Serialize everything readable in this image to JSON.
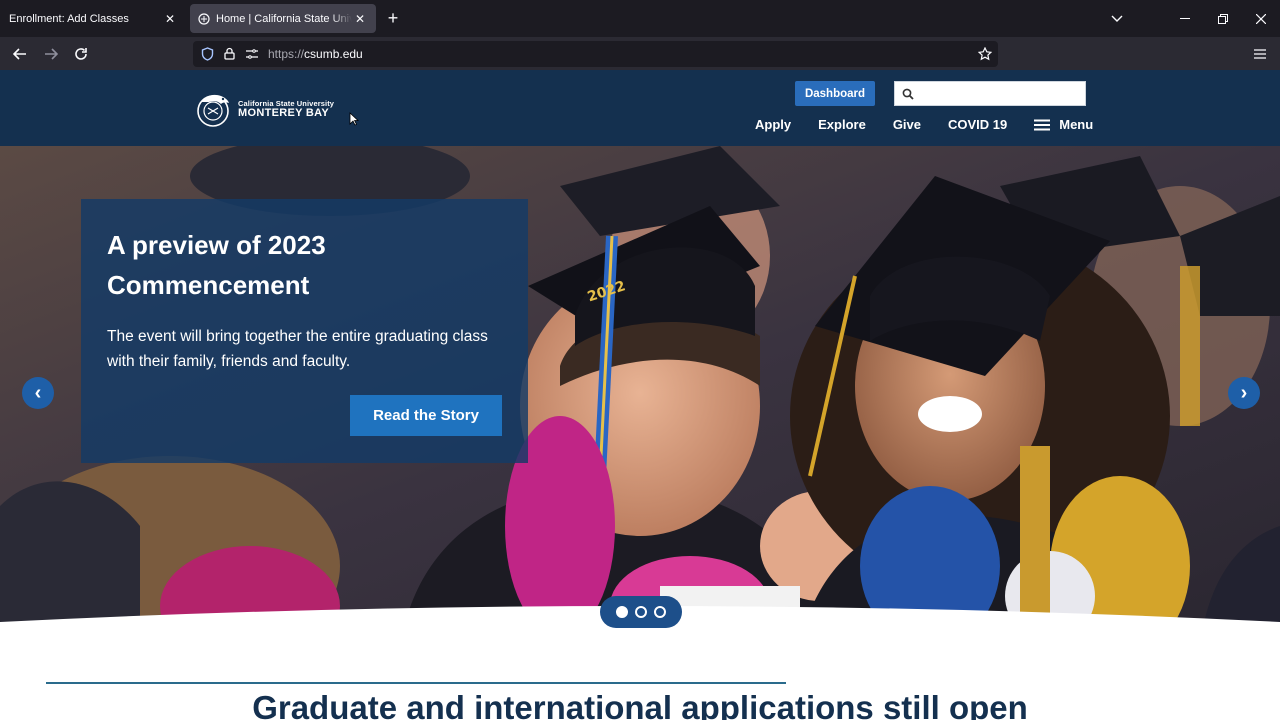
{
  "browser": {
    "tabs": [
      {
        "label": "Enrollment: Add Classes",
        "active": false
      },
      {
        "label": "Home | California State University",
        "active": true
      }
    ],
    "url": {
      "scheme": "https://",
      "host": "csumb.edu"
    }
  },
  "header": {
    "logo": {
      "top": "California State University",
      "bottom": "MONTEREY BAY"
    },
    "dashboard_label": "Dashboard",
    "search": {
      "placeholder": "",
      "value": ""
    },
    "nav": [
      {
        "label": "Apply"
      },
      {
        "label": "Explore"
      },
      {
        "label": "Give"
      },
      {
        "label": "COVID 19"
      },
      {
        "label": "Menu"
      }
    ]
  },
  "hero": {
    "title": "A preview of 2023 Commencement",
    "description": "The event will bring together the entire graduating class with their family, friends and faculty.",
    "button_label": "Read the Story",
    "prev_icon": "‹",
    "next_icon": "›",
    "slides_total": 3,
    "active_slide": 1,
    "photo_cap_text": "2022"
  },
  "section": {
    "title": "Graduate and international applications still open"
  },
  "colors": {
    "header_bg": "#14304f",
    "accent_blue": "#1f73bf",
    "dashboard_blue": "#2a6dbb",
    "card_bg": "#143a66"
  }
}
